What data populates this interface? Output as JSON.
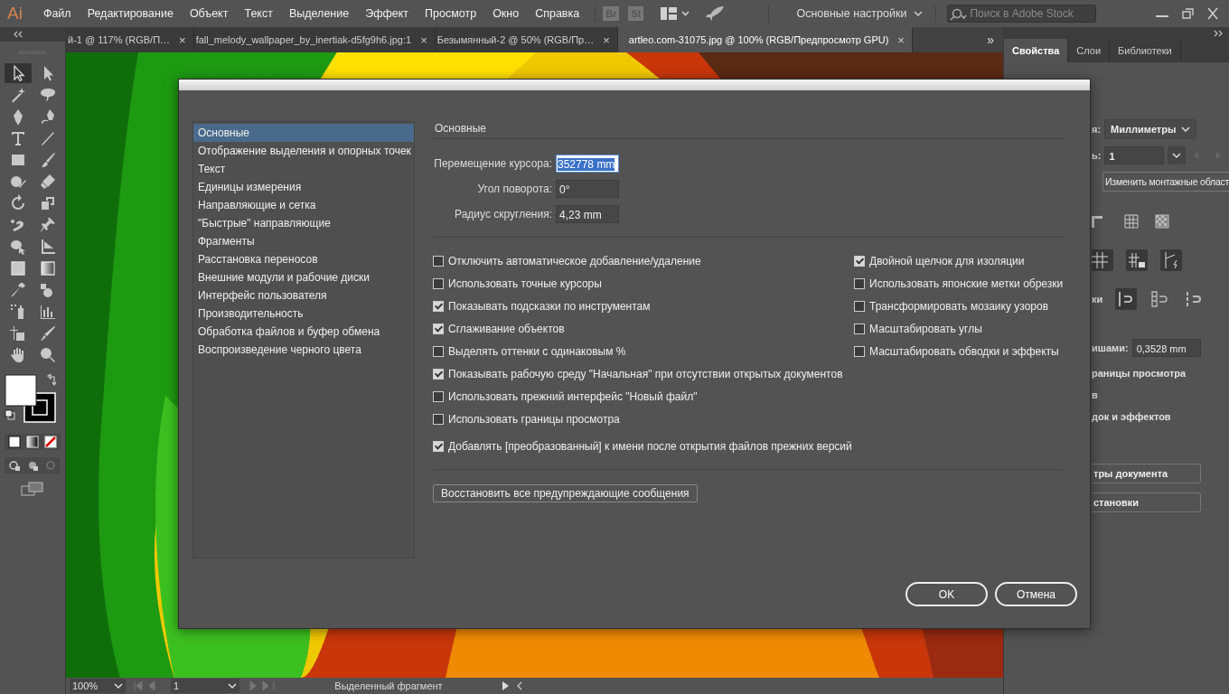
{
  "app_logo": "Ai",
  "menu": [
    "Файл",
    "Редактирование",
    "Объект",
    "Текст",
    "Выделение",
    "Эффект",
    "Просмотр",
    "Окно",
    "Справка"
  ],
  "app_badges": [
    "Br",
    "St"
  ],
  "workspace": "Основные настройки",
  "search": {
    "placeholder": "Поиск в Adobe Stock"
  },
  "document_tabs": [
    {
      "label": "й-1 @ 117% (RGB/П…",
      "close": "×",
      "selected": false
    },
    {
      "label": "fall_melody_wallpaper_by_inertiak-d5fg9h6.jpg:1",
      "close": "×",
      "selected": false
    },
    {
      "label": "Безымянный-2 @ 50% (RGB/Пр…",
      "close": "×",
      "selected": false
    },
    {
      "label": "artleo.com-31075.jpg @ 100% (RGB/Предпросмотр GPU)",
      "close": "×",
      "selected": true
    }
  ],
  "tabs_overflow": "»",
  "tools": [
    {
      "kind": "selection",
      "selected": true
    },
    {
      "kind": "direct",
      "selected": false
    },
    {
      "kind": "wand",
      "selected": false
    },
    {
      "kind": "lasso",
      "selected": false
    },
    {
      "kind": "pen",
      "selected": false
    },
    {
      "kind": "curvature",
      "selected": false
    },
    {
      "kind": "type",
      "selected": false
    },
    {
      "kind": "line",
      "selected": false
    },
    {
      "kind": "rectangle",
      "selected": false
    },
    {
      "kind": "brush",
      "selected": false
    },
    {
      "kind": "shaper",
      "selected": false
    },
    {
      "kind": "eraser",
      "selected": false
    },
    {
      "kind": "rotate",
      "selected": false
    },
    {
      "kind": "scale",
      "selected": false
    },
    {
      "kind": "puppet",
      "selected": false
    },
    {
      "kind": "pin",
      "selected": false
    },
    {
      "kind": "builder",
      "selected": false
    },
    {
      "kind": "perspective",
      "selected": false
    },
    {
      "kind": "mesh",
      "selected": false
    },
    {
      "kind": "gradient",
      "selected": false
    },
    {
      "kind": "eyedropper",
      "selected": false
    },
    {
      "kind": "blend",
      "selected": false
    },
    {
      "kind": "sprayer",
      "selected": false
    },
    {
      "kind": "graph",
      "selected": false
    },
    {
      "kind": "artboard",
      "selected": false
    },
    {
      "kind": "knife",
      "selected": false
    },
    {
      "kind": "hand",
      "selected": false
    },
    {
      "kind": "zoom",
      "selected": false
    }
  ],
  "status_bar": {
    "zoom": "100%",
    "artboard": "1",
    "info": "Выделенный фрагмент"
  },
  "panel": {
    "tabs": [
      {
        "label": "Свойства",
        "selected": true
      },
      {
        "label": "Слои",
        "selected": false
      },
      {
        "label": "Библиотеки",
        "selected": false
      }
    ],
    "units_label": "я:",
    "units": "Миллиметры",
    "artboard_label": "ь:",
    "artboard": "1",
    "edit_artboards": "Изменить монтажные област",
    "snap_label": "ки",
    "keyboard_label": "ишами:",
    "keyboard_value": "0,3528 mm",
    "texts": [
      "раницы просмотра",
      "в",
      "док и эффектов"
    ],
    "buttons": [
      "тры документа",
      "становки"
    ]
  },
  "dialog": {
    "categories": [
      {
        "label": "Основные",
        "selected": true
      },
      {
        "label": "Отображение выделения и опорных точек",
        "selected": false
      },
      {
        "label": "Текст",
        "selected": false
      },
      {
        "label": "Единицы измерения",
        "selected": false
      },
      {
        "label": "Направляющие и сетка",
        "selected": false
      },
      {
        "label": "\"Быстрые\" направляющие",
        "selected": false
      },
      {
        "label": "Фрагменты",
        "selected": false
      },
      {
        "label": "Расстановка переносов",
        "selected": false
      },
      {
        "label": "Внешние модули и рабочие диски",
        "selected": false
      },
      {
        "label": "Интерфейс пользователя",
        "selected": false
      },
      {
        "label": "Производительность",
        "selected": false
      },
      {
        "label": "Обработка файлов и буфер обмена",
        "selected": false
      },
      {
        "label": "Воспроизведение черного цвета",
        "selected": false
      }
    ],
    "heading": "Основные",
    "fields": [
      {
        "label": "Перемещение курсора:",
        "value": "352778 mm",
        "highlighted": true
      },
      {
        "label": "Угол поворота:",
        "value": "0°",
        "highlighted": false
      },
      {
        "label": "Радиус скругления:",
        "value": "4,23 mm",
        "highlighted": false
      }
    ],
    "checkboxes_left": [
      {
        "label": "Отключить автоматическое добавление/удаление",
        "checked": false
      },
      {
        "label": "Использовать точные курсоры",
        "checked": false
      },
      {
        "label": "Показывать подсказки по инструментам",
        "checked": true
      },
      {
        "label": "Сглаживание объектов",
        "checked": true
      },
      {
        "label": "Выделять оттенки с одинаковым %",
        "checked": false
      }
    ],
    "checkboxes_right": [
      {
        "label": "Двойной щелчок для изоляции",
        "checked": true
      },
      {
        "label": "Использовать японские метки обрезки",
        "checked": false
      },
      {
        "label": "Трансформировать мозаику узоров",
        "checked": false
      },
      {
        "label": "Масштабировать углы",
        "checked": false
      },
      {
        "label": "Масштабировать обводки и эффекты",
        "checked": false
      }
    ],
    "checkboxes_wide": [
      {
        "label": "Показывать рабочую среду \"Начальная\" при отсутствии открытых документов",
        "checked": true
      },
      {
        "label": "Использовать прежний интерфейс \"Новый файл\"",
        "checked": false
      },
      {
        "label": "Использовать границы просмотра",
        "checked": false
      }
    ],
    "checkbox_last": {
      "label": "Добавлять [преобразованный] к имени после открытия файлов прежних версий",
      "checked": true
    },
    "reset_button": "Восстановить все предупреждающие сообщения",
    "ok": "OK",
    "cancel": "Отмена"
  }
}
